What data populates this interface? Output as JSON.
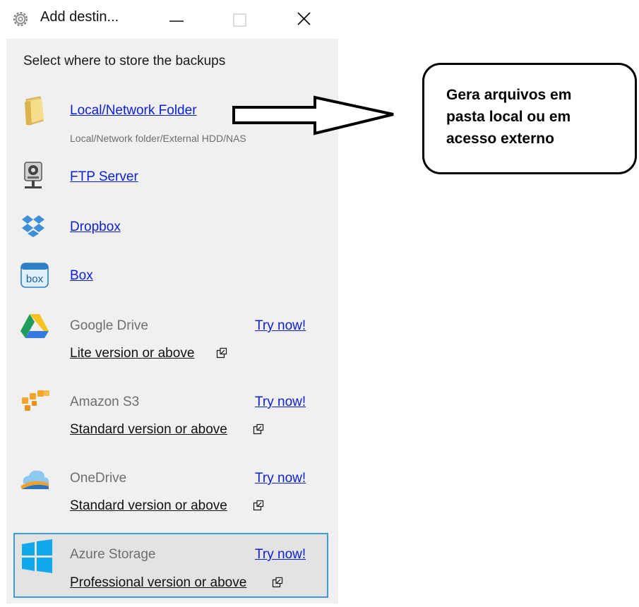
{
  "window": {
    "title": "Add destin...",
    "gear_icon": "gear-icon",
    "minimize_icon": "minimize-icon",
    "maximize_icon": "maximize-icon",
    "close_icon": "close-icon"
  },
  "panel": {
    "heading": "Select where to store the backups",
    "destinations": [
      {
        "name": "Local/Network Folder",
        "subtitle": "Local/Network folder/External HDD/NAS",
        "icon": "folder-icon"
      },
      {
        "name": "FTP Server",
        "icon": "ftp-server-icon"
      },
      {
        "name": "Dropbox",
        "icon": "dropbox-icon"
      },
      {
        "name": "Box",
        "icon": "box-icon"
      }
    ],
    "premium_destinations": [
      {
        "name": "Google Drive",
        "try_label": "Try now!",
        "edition": "Lite version or above",
        "icon": "google-drive-icon"
      },
      {
        "name": "Amazon S3",
        "try_label": "Try now!",
        "edition": "Standard version or above",
        "icon": "amazon-s3-icon"
      },
      {
        "name": "OneDrive",
        "try_label": "Try now!",
        "edition": "Standard version or above",
        "icon": "onedrive-icon"
      },
      {
        "name": "Azure Storage",
        "try_label": "Try now!",
        "edition": "Professional version or above",
        "icon": "windows-azure-icon"
      }
    ],
    "external_link_icon": "external-link-icon"
  },
  "annotation": {
    "callout_text": "Gera arquivos em\npasta local ou em\nacesso externo",
    "arrow_icon": "arrow-left-icon"
  },
  "colors": {
    "link": "#0b1fd6",
    "panel_bg": "#f0f0f0",
    "selected_border": "#3f9ad6"
  }
}
